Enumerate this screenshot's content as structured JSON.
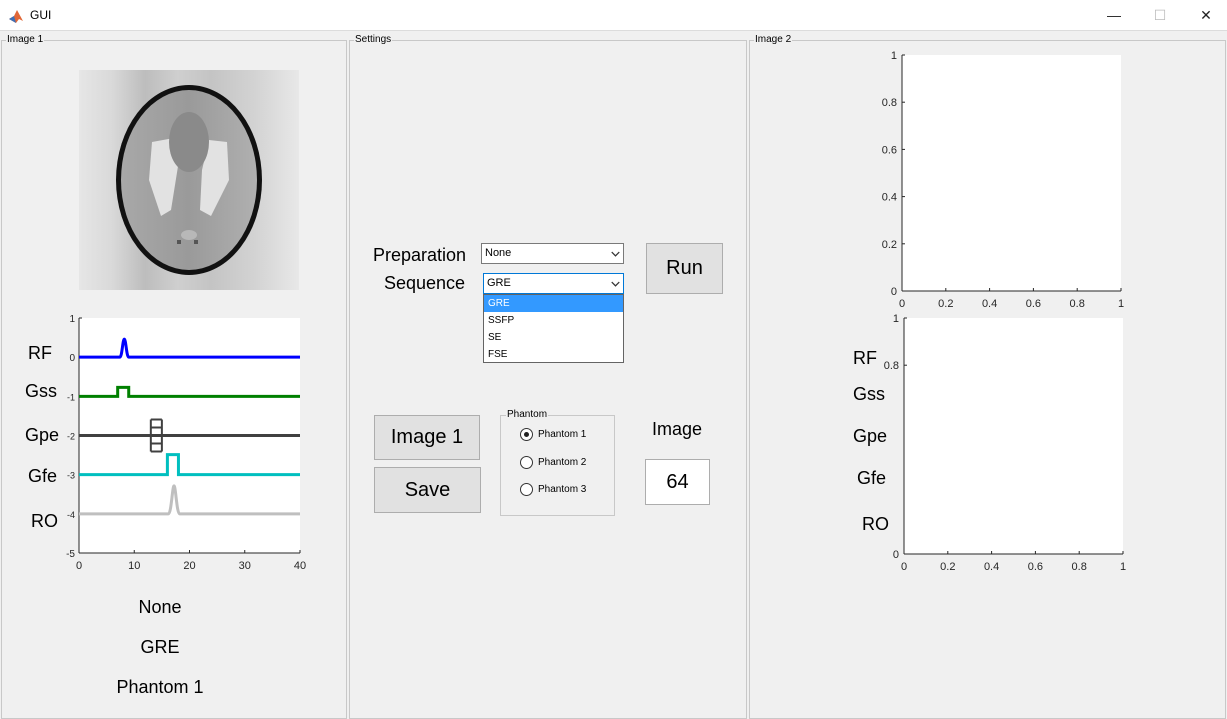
{
  "window": {
    "title": "GUI"
  },
  "panels": {
    "image1": "Image 1",
    "settings": "Settings",
    "image2": "Image 2",
    "phantom": "Phantom"
  },
  "settings": {
    "preparation_label": "Preparation",
    "preparation_value": "None",
    "sequence_label": "Sequence",
    "sequence_value": "GRE",
    "sequence_options": [
      "GRE",
      "SSFP",
      "SE",
      "FSE"
    ],
    "run_label": "Run",
    "image1_label": "Image 1",
    "save_label": "Save",
    "image_label": "Image",
    "image_value": "64",
    "phantom_options": [
      "Phantom 1",
      "Phantom 2",
      "Phantom 3"
    ],
    "phantom_selected": "Phantom 1"
  },
  "status": {
    "preparation": "None",
    "sequence": "GRE",
    "phantom": "Phantom 1"
  },
  "seq_labels": [
    "RF",
    "Gss",
    "Gpe",
    "Gfe",
    "RO"
  ],
  "chart_data": [
    {
      "type": "line",
      "series": [
        {
          "name": "RF",
          "color": "#0000ff",
          "offset": 0
        },
        {
          "name": "Gss",
          "color": "#008000",
          "offset": -1
        },
        {
          "name": "Gpe",
          "color": "#404040",
          "offset": -2
        },
        {
          "name": "Gfe",
          "color": "#00bfbf",
          "offset": -3
        },
        {
          "name": "RO",
          "color": "#bfbfbf",
          "offset": -4
        }
      ],
      "xlim": [
        0,
        40
      ],
      "ylim": [
        -5,
        1
      ],
      "xticks": [
        "0",
        "10",
        "20",
        "30",
        "40"
      ],
      "yticks": [
        "1",
        "0",
        "-1",
        "-2",
        "-3",
        "-4",
        "-5"
      ]
    },
    {
      "type": "line",
      "xlim": [
        0,
        1
      ],
      "ylim": [
        0,
        1
      ],
      "xticks": [
        "0",
        "0.2",
        "0.4",
        "0.6",
        "0.8",
        "1"
      ],
      "yticks": [
        "0",
        "0.2",
        "0.4",
        "0.6",
        "0.8",
        "1"
      ]
    },
    {
      "type": "line",
      "xlim": [
        0,
        1
      ],
      "ylim": [
        0,
        1
      ],
      "xticks": [
        "0",
        "0.2",
        "0.4",
        "0.6",
        "0.8",
        "1"
      ],
      "yticks": [
        "0",
        "0.8",
        "1"
      ]
    }
  ]
}
